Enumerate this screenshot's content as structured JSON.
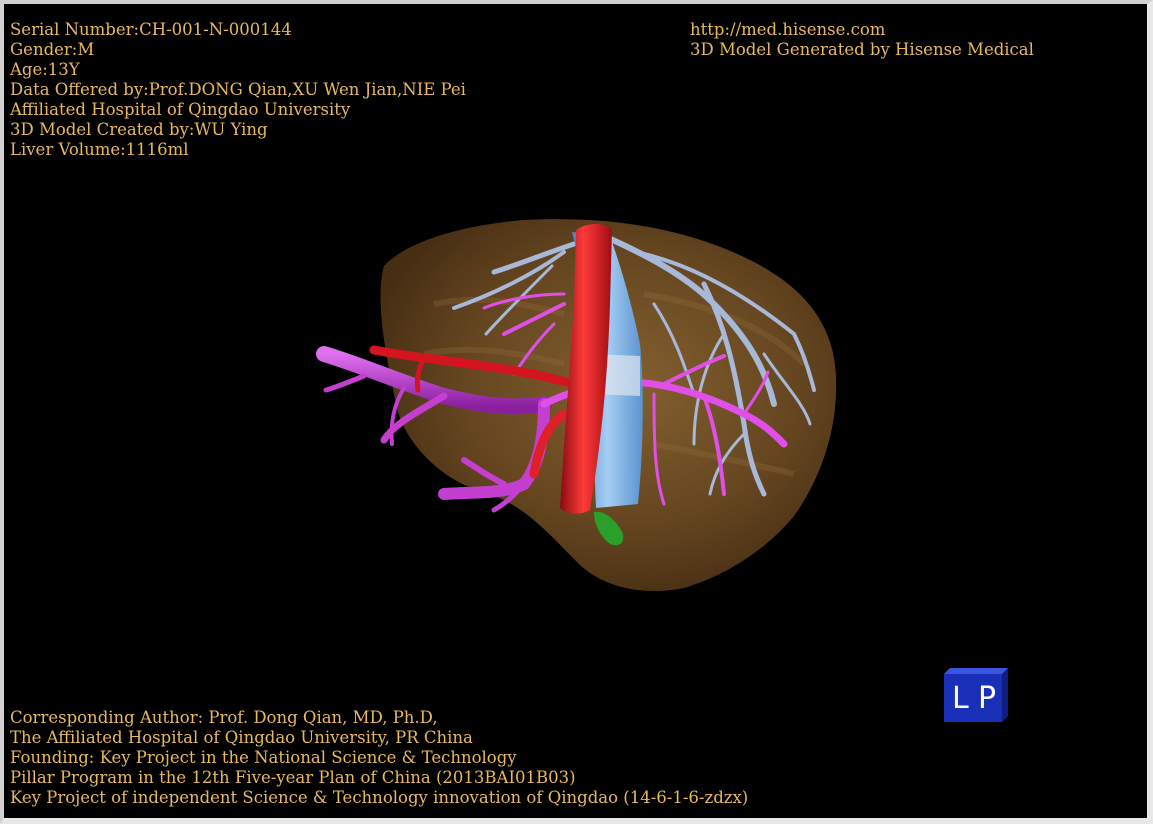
{
  "patient_info": {
    "serial_number": "Serial Number:CH-001-N-000144",
    "gender": "Gender:M",
    "age": "Age:13Y",
    "data_offered": "Data Offered by:Prof.DONG Qian,XU Wen Jian,NIE Pei",
    "hospital": "Affiliated Hospital of Qingdao University",
    "model_created": "3D Model Created by:WU Ying",
    "liver_volume": "Liver Volume:1116ml"
  },
  "site_info": {
    "url": "http://med.hisense.com",
    "generator": "3D Model Generated by Hisense Medical"
  },
  "credits": {
    "line1": "Corresponding Author: Prof. Dong Qian, MD, Ph.D,",
    "line2": "The Affiliated Hospital of Qingdao University, PR China",
    "line3": "Founding: Key Project in the National Science & Technology",
    "line4": "Pillar Program in the 12th Five-year Plan of China (2013BAI01B03)",
    "line5": "Key Project of independent Science & Technology innovation of Qingdao (14-6-1-6-zdzx)"
  },
  "orientation": {
    "left_label": "L",
    "right_label": "P"
  },
  "colors": {
    "text": "#e8b860",
    "liver": "#6b4a22",
    "artery": "#d4141e",
    "portal_vein": "#c43fd0",
    "hepatic_vein": "#a8b8d8",
    "ivc": "#7fb4e8",
    "gallbladder": "#2aa02a",
    "cube": "#1a2fb8"
  }
}
